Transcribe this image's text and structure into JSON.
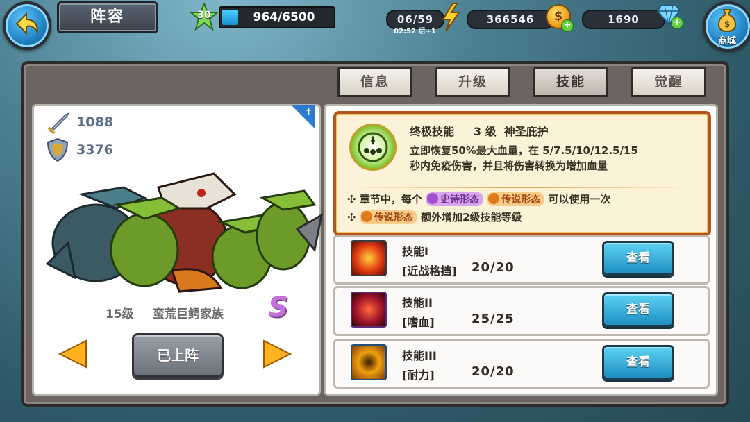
{
  "header": {
    "title": "阵容",
    "player_level": "30",
    "exp_text": "964/6500",
    "exp_fraction": 0.148,
    "stamina": "06/59",
    "stamina_timer": "02:52 后+1",
    "gold": "366546",
    "diamonds": "1690",
    "shop_label": "商城"
  },
  "tabs": [
    {
      "label": "信息",
      "active": false
    },
    {
      "label": "升级",
      "active": false
    },
    {
      "label": "技能",
      "active": true
    },
    {
      "label": "觉醒",
      "active": false
    }
  ],
  "hero": {
    "attack": "1088",
    "defense": "3376",
    "level": "15级",
    "name": "蛮荒巨鳄家族",
    "rank": "S",
    "deploy_label": "已上阵"
  },
  "ultimate": {
    "title_label": "终极技能",
    "level_text": "3 级",
    "name": "神圣庇护",
    "desc_line1": "立即恢复50%最大血量，在 5/7.5/10/12.5/15",
    "desc_line2": "秒内免疫伤害，并且将伤害转换为增加血量",
    "note1_prefix": "章节中，每个",
    "note1_badge1": "史诗形态",
    "note1_badge2": "传说形态",
    "note1_suffix": "可以使用一次",
    "note2_badge": "传说形态",
    "note2_suffix": "额外增加2级技能等级"
  },
  "skills": [
    {
      "name": "技能I",
      "desc": "[近战格挡]",
      "level": "20/20",
      "button": "查看",
      "color": "#e23a12"
    },
    {
      "name": "技能II",
      "desc": "[嗜血]",
      "level": "25/25",
      "button": "查看",
      "color": "#a0132a"
    },
    {
      "name": "技能III",
      "desc": "[耐力]",
      "level": "20/20",
      "button": "查看",
      "color": "#f1a010"
    }
  ],
  "colors": {
    "accent_blue": "#1e8fc2",
    "ultimate_border": "#b3561b"
  }
}
